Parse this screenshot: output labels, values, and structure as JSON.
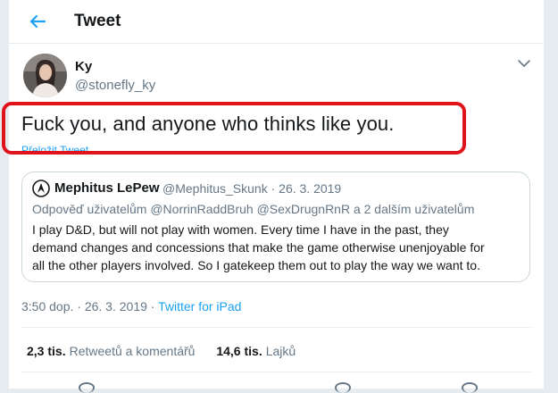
{
  "header": {
    "title": "Tweet",
    "back_icon": "arrow-left-icon"
  },
  "author": {
    "name": "Ky",
    "handle": "@stonefly_ky"
  },
  "tweet": {
    "text": "Fuck you, and anyone who thinks like you.",
    "translate": "Přeložit Tweet"
  },
  "quoted": {
    "name": "Mephitus LePew",
    "meta": "@Mephitus_Skunk · 26. 3. 2019",
    "reply_to": "Odpověď uživatelům @NorrinRaddBruh @SexDrugnRnR a 2 dalším uživatelům",
    "body_lines": [
      "I play D&D, but will not play with women. Every time I have in the past, they",
      "demand changes and concessions that make the game otherwise unenjoyable for",
      "all the other players involved. So I gatekeep them out to play the way we want to."
    ]
  },
  "timestamp": {
    "time": "3:50 dop. · 26. 3. 2019 · ",
    "source": "Twitter for iPad"
  },
  "stats": {
    "retweets_count": "2,3 tis.",
    "retweets_label": "Retweetů a komentářů",
    "likes_count": "14,6 tis.",
    "likes_label": "Lajků"
  },
  "colors": {
    "accent": "#1da1f2",
    "highlight": "#e0121b",
    "muted": "#657786"
  }
}
